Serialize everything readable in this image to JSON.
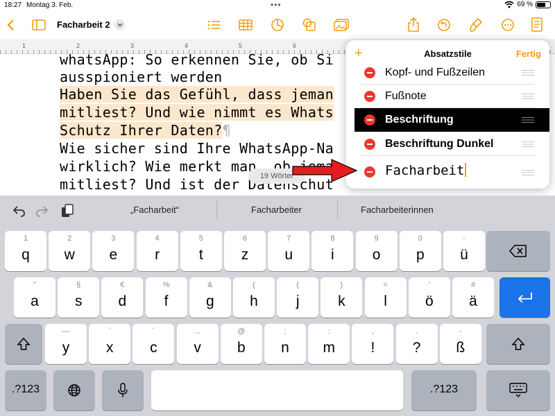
{
  "status_bar": {
    "time": "18:27",
    "date": "Montag 3. Feb.",
    "battery": "69 %",
    "battery_level": 0.69
  },
  "toolbar": {
    "document_title": "Facharbeit 2",
    "left_icons": [
      "back-chevron-icon",
      "sidebar-icon"
    ],
    "center_icons": [
      "list-icon",
      "table-icon",
      "chart-icon",
      "shapes-icon",
      "media-icon"
    ],
    "right_icons": [
      "share-icon",
      "undo-history-icon",
      "format-brush-icon",
      "more-icon",
      "document-icon"
    ],
    "accent_color": "#F39C12"
  },
  "ruler": {
    "numbers": [
      "1",
      "2",
      "3",
      "4",
      "5",
      "6"
    ]
  },
  "document": {
    "lines": [
      {
        "text": "whatsApp: So erkennen Sie, ob Si",
        "highlight": false
      },
      {
        "text": "ausspioniert werden",
        "highlight": false
      },
      {
        "text": "Haben Sie das Gefühl, dass jeman",
        "highlight": true
      },
      {
        "text": "mitliest? Und wie nimmt es Whats",
        "highlight": true
      },
      {
        "text": "Schutz Ihrer Daten?",
        "highlight": true,
        "pilcrow": "¶"
      },
      {
        "text": "Wie sicher sind Ihre WhatsApp-Na",
        "highlight": false
      },
      {
        "text": "wirklich? Wie merkt man, ob jema",
        "highlight": false
      },
      {
        "text": "mitliest? Und ist der Datenschut",
        "highlight": false
      }
    ],
    "word_count": "19 Wörter",
    "highlight_color": "#FBE7CC"
  },
  "styles_popover": {
    "title": "Absatzstile",
    "add_label": "+",
    "done_label": "Fertig",
    "items": [
      {
        "name": "Kopf- und Fußzeilen",
        "selected": false
      },
      {
        "name": "Fußnote",
        "selected": false
      },
      {
        "name": "Beschriftung",
        "selected": true
      },
      {
        "name": "Beschriftung Dunkel",
        "selected": false
      }
    ],
    "editing_item": {
      "name": "Facharbeit"
    },
    "delete_color": "#E8392F"
  },
  "annotation": {
    "arrow_color": "#E41E1E"
  },
  "keyboard": {
    "suggestions": [
      "„Facharbeit“",
      "Facharbeiter",
      "Facharbeiterinnen"
    ],
    "row1": [
      {
        "primary": "q",
        "secondary": "1"
      },
      {
        "primary": "w",
        "secondary": "2"
      },
      {
        "primary": "e",
        "secondary": "3"
      },
      {
        "primary": "r",
        "secondary": "4"
      },
      {
        "primary": "t",
        "secondary": "5"
      },
      {
        "primary": "z",
        "secondary": "6"
      },
      {
        "primary": "u",
        "secondary": "7"
      },
      {
        "primary": "i",
        "secondary": "8"
      },
      {
        "primary": "o",
        "secondary": "9"
      },
      {
        "primary": "p",
        "secondary": "0"
      },
      {
        "primary": "ü",
        "secondary": "-"
      }
    ],
    "row2": [
      {
        "primary": "a",
        "secondary": "\""
      },
      {
        "primary": "s",
        "secondary": "§"
      },
      {
        "primary": "d",
        "secondary": "€"
      },
      {
        "primary": "f",
        "secondary": "%"
      },
      {
        "primary": "g",
        "secondary": "&"
      },
      {
        "primary": "h",
        "secondary": "("
      },
      {
        "primary": "j",
        "secondary": "("
      },
      {
        "primary": "k",
        "secondary": ")"
      },
      {
        "primary": "l",
        "secondary": "="
      },
      {
        "primary": "ö",
        "secondary": "'"
      },
      {
        "primary": "ä",
        "secondary": "#"
      }
    ],
    "row3": [
      {
        "primary": "y",
        "secondary": "—"
      },
      {
        "primary": "x",
        "secondary": "`"
      },
      {
        "primary": "c",
        "secondary": "´"
      },
      {
        "primary": "v",
        "secondary": "..."
      },
      {
        "primary": "b",
        "secondary": "@"
      },
      {
        "primary": "n",
        "secondary": ";"
      },
      {
        "primary": "m",
        "secondary": ":"
      },
      {
        "primary": "!",
        "secondary": ","
      },
      {
        "primary": "?",
        "secondary": "."
      },
      {
        "primary": "ß",
        "secondary": "-"
      }
    ],
    "numbers_label": ".?123",
    "return_color": "#1A73E8"
  }
}
